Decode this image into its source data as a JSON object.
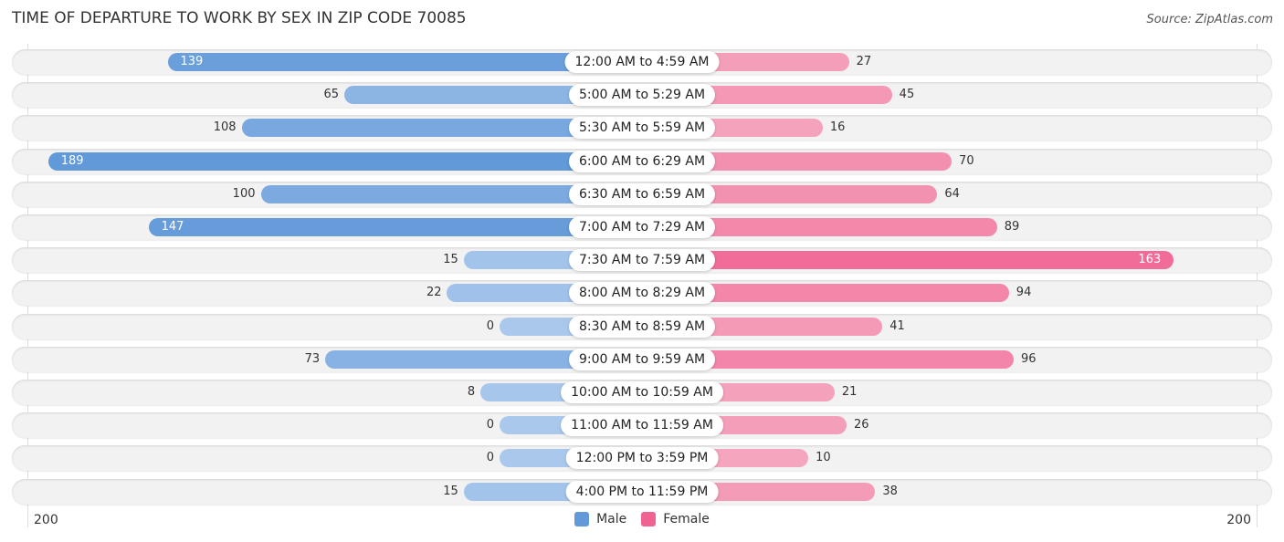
{
  "chart_data": {
    "type": "bar",
    "orientation": "horizontal-diverging",
    "title": "TIME OF DEPARTURE TO WORK BY SEX IN ZIP CODE 70085",
    "source": "Source: ZipAtlas.com",
    "categories": [
      "12:00 AM to 4:59 AM",
      "5:00 AM to 5:29 AM",
      "5:30 AM to 5:59 AM",
      "6:00 AM to 6:29 AM",
      "6:30 AM to 6:59 AM",
      "7:00 AM to 7:29 AM",
      "7:30 AM to 7:59 AM",
      "8:00 AM to 8:29 AM",
      "8:30 AM to 8:59 AM",
      "9:00 AM to 9:59 AM",
      "10:00 AM to 10:59 AM",
      "11:00 AM to 11:59 AM",
      "12:00 PM to 3:59 PM",
      "4:00 PM to 11:59 PM"
    ],
    "series": [
      {
        "name": "Male",
        "color": "#6199d9",
        "light_color": "#aac8ec",
        "side": "left",
        "values": [
          139,
          65,
          108,
          189,
          100,
          147,
          15,
          22,
          0,
          73,
          8,
          0,
          0,
          15
        ]
      },
      {
        "name": "Female",
        "color": "#f06292",
        "light_color": "#f5a9c0",
        "side": "right",
        "values": [
          27,
          45,
          16,
          70,
          64,
          89,
          163,
          94,
          41,
          96,
          21,
          26,
          10,
          38
        ]
      }
    ],
    "axis": {
      "left_max_label": "200",
      "right_max_label": "200",
      "range": [
        0,
        200
      ]
    },
    "legend": {
      "position": "bottom-center",
      "items": [
        "Male",
        "Female"
      ]
    },
    "grid": true
  }
}
